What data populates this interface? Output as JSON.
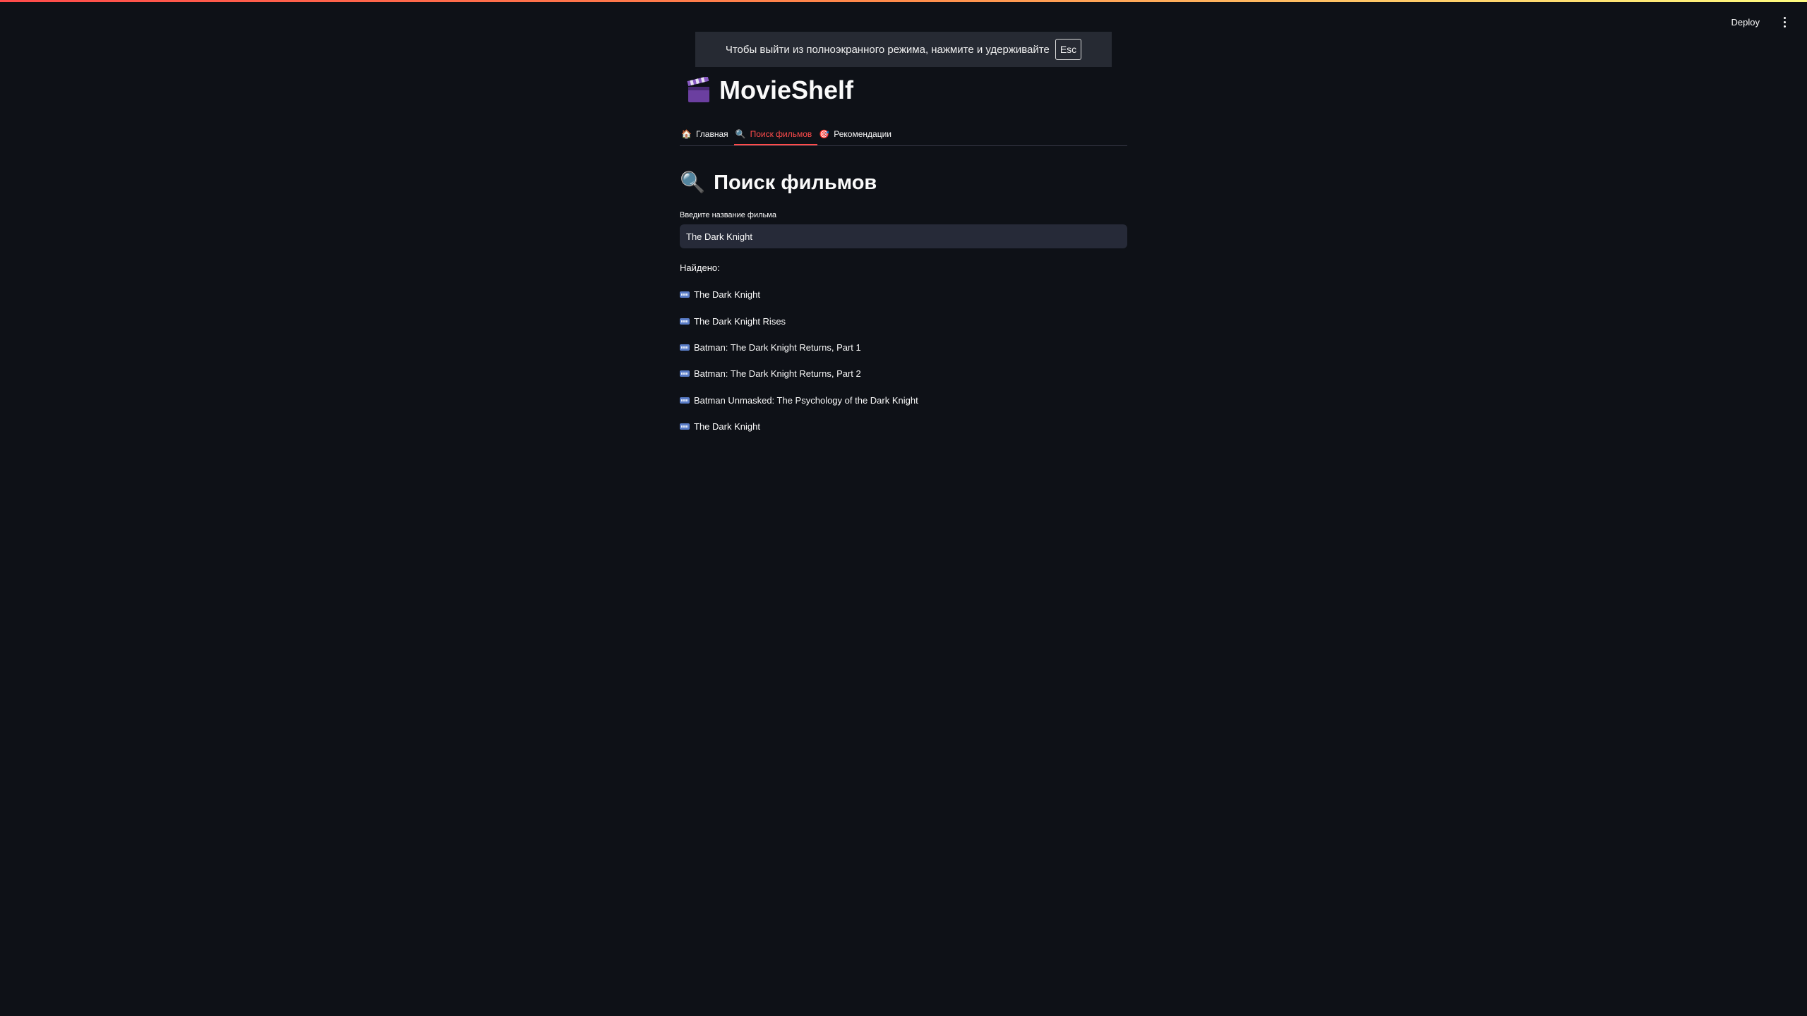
{
  "toolbar": {
    "deploy_label": "Deploy",
    "menu_icon": "kebab-menu-icon"
  },
  "fullscreen_notice": {
    "text": "Чтобы выйти из полноэкранного режима, нажмите и удерживайте",
    "key": "Esc"
  },
  "app": {
    "title": "MovieShelf",
    "icon": "clapperboard-icon"
  },
  "tabs": [
    {
      "label": "Главная",
      "icon": "house-icon",
      "active": false
    },
    {
      "label": "Поиск фильмов",
      "icon": "magnifier-icon",
      "active": true
    },
    {
      "label": "Рекомендации",
      "icon": "target-icon",
      "active": false
    }
  ],
  "search": {
    "heading": "Поиск фильмов",
    "heading_icon": "magnifier-icon",
    "label": "Введите название фильма",
    "value": "The Dark Knight",
    "found_label": "Найдено:"
  },
  "results": [
    "The Dark Knight",
    "The Dark Knight Rises",
    "Batman: The Dark Knight Returns, Part 1",
    "Batman: The Dark Knight Returns, Part 2",
    "Batman Unmasked: The Psychology of the Dark Knight",
    "The Dark Knight"
  ],
  "colors": {
    "background": "#0e1117",
    "accent": "#ff4b4b",
    "input_bg": "#262a38"
  }
}
